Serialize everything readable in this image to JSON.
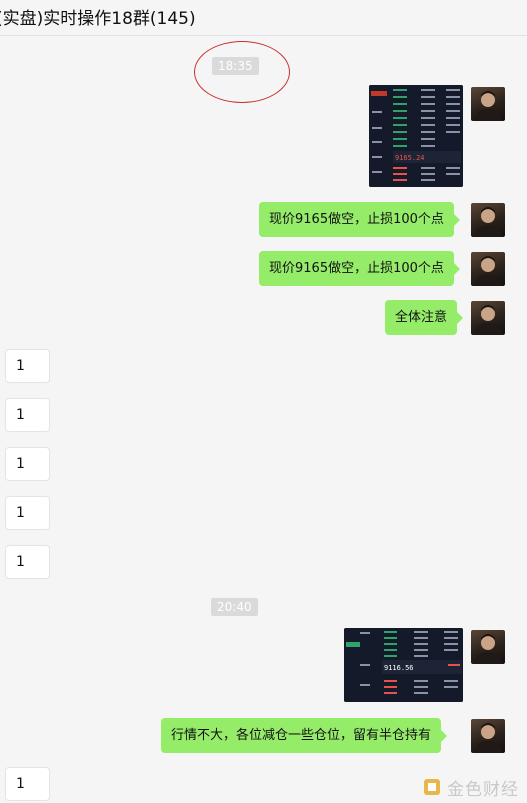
{
  "header": {
    "title": "(实盘)实时操作18群(145)"
  },
  "timestamps": [
    "18:35",
    "20:40"
  ],
  "messages": {
    "m1": "现价9165做空，止损100个点",
    "m2": "现价9165做空，止损100个点",
    "m3": "全体注意",
    "m4": "行情不大，各位减仓一些仓位，留有半仓持有"
  },
  "replies": [
    "1",
    "1",
    "1",
    "1",
    "1",
    "1"
  ],
  "screenshot1": {
    "price": "9165.24"
  },
  "screenshot2": {
    "price": "9116.56"
  },
  "watermark": {
    "text": "金色财经"
  },
  "colors": {
    "bubble_green": "#95ec69",
    "highlight_circle": "#c8302f"
  }
}
